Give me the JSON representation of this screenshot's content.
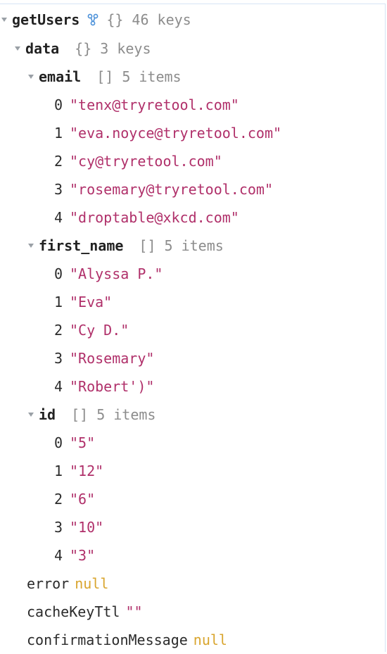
{
  "root": {
    "key": "getUsers",
    "brackets": "{}",
    "count": "46 keys"
  },
  "data": {
    "key": "data",
    "brackets": "{}",
    "count": "3 keys",
    "email": {
      "key": "email",
      "brackets": "[]",
      "count": "5 items",
      "items": [
        {
          "index": "0",
          "value": "\"tenx@tryretool.com\""
        },
        {
          "index": "1",
          "value": "\"eva.noyce@tryretool.com\""
        },
        {
          "index": "2",
          "value": "\"cy@tryretool.com\""
        },
        {
          "index": "3",
          "value": "\"rosemary@tryretool.com\""
        },
        {
          "index": "4",
          "value": "\"droptable@xkcd.com\""
        }
      ]
    },
    "first_name": {
      "key": "first_name",
      "brackets": "[]",
      "count": "5 items",
      "items": [
        {
          "index": "0",
          "value": "\"Alyssa P.\""
        },
        {
          "index": "1",
          "value": "\"Eva\""
        },
        {
          "index": "2",
          "value": "\"Cy D.\""
        },
        {
          "index": "3",
          "value": "\"Rosemary\""
        },
        {
          "index": "4",
          "value": "\"Robert')\""
        }
      ]
    },
    "id": {
      "key": "id",
      "brackets": "[]",
      "count": "5 items",
      "items": [
        {
          "index": "0",
          "value": "\"5\""
        },
        {
          "index": "1",
          "value": "\"12\""
        },
        {
          "index": "2",
          "value": "\"6\""
        },
        {
          "index": "3",
          "value": "\"10\""
        },
        {
          "index": "4",
          "value": "\"3\""
        }
      ]
    }
  },
  "error": {
    "key": "error",
    "value": "null"
  },
  "cacheKeyTtl": {
    "key": "cacheKeyTtl",
    "value": "\"\""
  },
  "confirmationMessage": {
    "key": "confirmationMessage",
    "value": "null"
  },
  "colors": {
    "string": "#b0306a",
    "null": "#d9a52e",
    "meta": "#8c8c8c",
    "icon": "#4a90d9"
  },
  "icons": {
    "root": "link-icon"
  }
}
